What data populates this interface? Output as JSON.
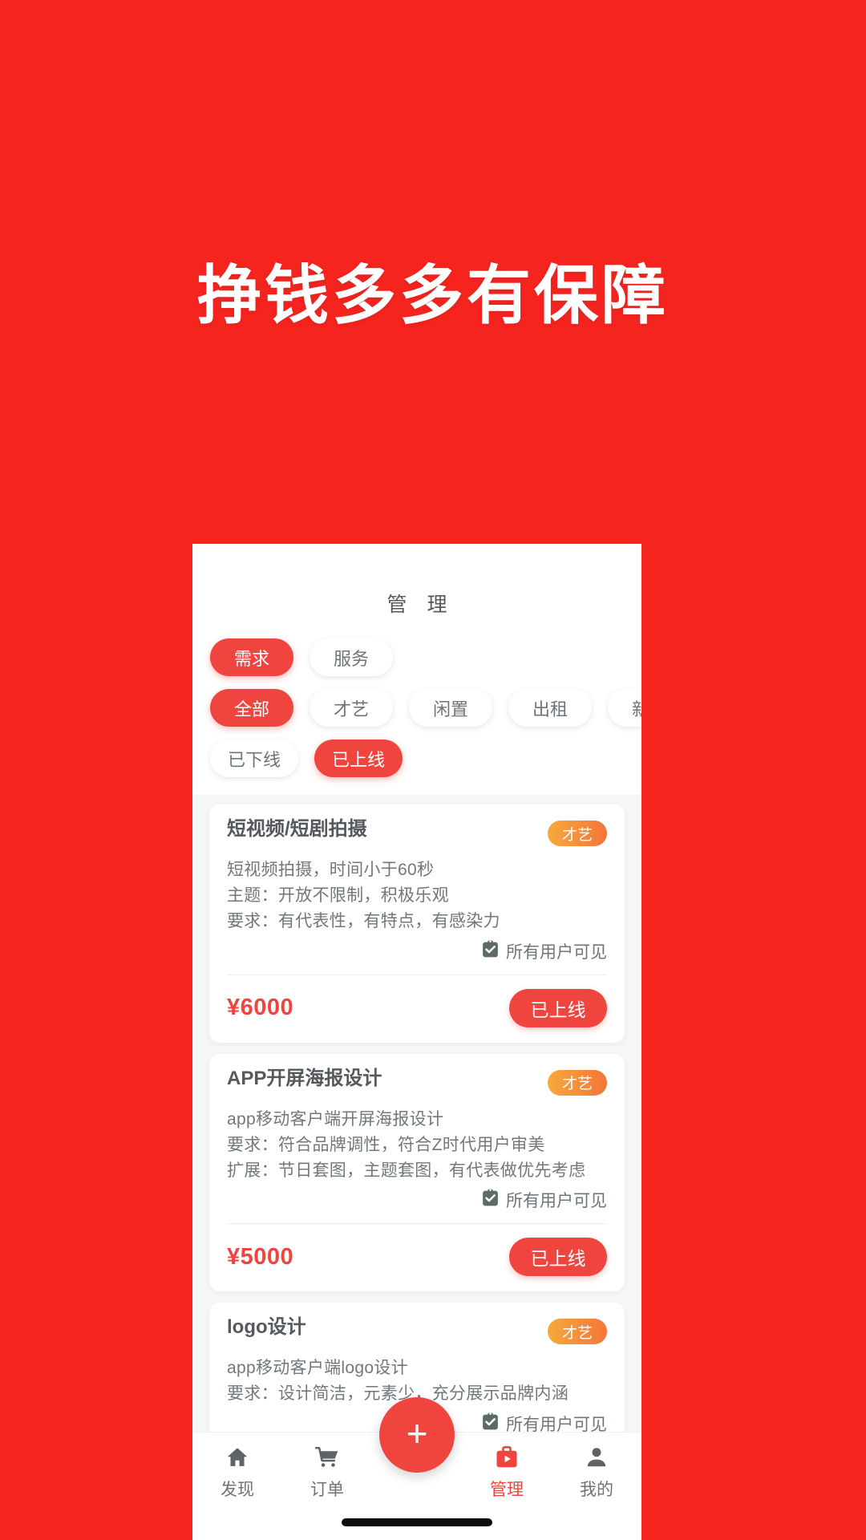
{
  "hero": {
    "headline": "挣钱多多有保障",
    "background_color": "#f5241f",
    "text_color": "#ffffff"
  },
  "app": {
    "title": "管 理",
    "accent_color": "#f0453e"
  },
  "filters": {
    "rows": [
      {
        "name": "type",
        "chips": [
          {
            "label": "需求",
            "active": true
          },
          {
            "label": "服务",
            "active": false
          }
        ]
      },
      {
        "name": "category",
        "chips": [
          {
            "label": "全部",
            "active": true
          },
          {
            "label": "才艺",
            "active": false
          },
          {
            "label": "闲置",
            "active": false
          },
          {
            "label": "出租",
            "active": false
          },
          {
            "label": "新品",
            "active": false
          }
        ]
      },
      {
        "name": "status",
        "chips": [
          {
            "label": "已下线",
            "active": false
          },
          {
            "label": "已上线",
            "active": true
          }
        ]
      }
    ]
  },
  "cards": [
    {
      "title": "短视频/短剧拍摄",
      "tag": "才艺",
      "lines": [
        "短视频拍摄，时间小于60秒",
        "主题：开放不限制，积极乐观",
        "要求：有代表性，有特点，有感染力"
      ],
      "visibility": "所有用户可见",
      "visibility_icon": "clipboard-check-icon",
      "price": "¥6000",
      "status": "已上线"
    },
    {
      "title": "APP开屏海报设计",
      "tag": "才艺",
      "lines": [
        "app移动客户端开屏海报设计",
        "要求：符合品牌调性，符合Z时代用户审美",
        "扩展：节日套图，主题套图，有代表做优先考虑"
      ],
      "visibility": "所有用户可见",
      "visibility_icon": "clipboard-check-icon",
      "price": "¥5000",
      "status": "已上线"
    },
    {
      "title": "logo设计",
      "tag": "才艺",
      "lines": [
        "app移动客户端logo设计",
        "要求：设计简洁，元素少，充分展示品牌内涵"
      ],
      "visibility": "所有用户可见",
      "visibility_icon": "clipboard-check-icon",
      "price": "",
      "status": ""
    }
  ],
  "bottom_nav": {
    "items": [
      {
        "label": "发现",
        "icon": "home-icon",
        "active": false
      },
      {
        "label": "订单",
        "icon": "shopping-cart-icon",
        "active": false
      },
      {
        "label": "管理",
        "icon": "briefcase-play-icon",
        "active": true
      },
      {
        "label": "我的",
        "icon": "person-icon",
        "active": false
      }
    ],
    "fab": {
      "icon": "plus-icon",
      "label": "+"
    }
  }
}
